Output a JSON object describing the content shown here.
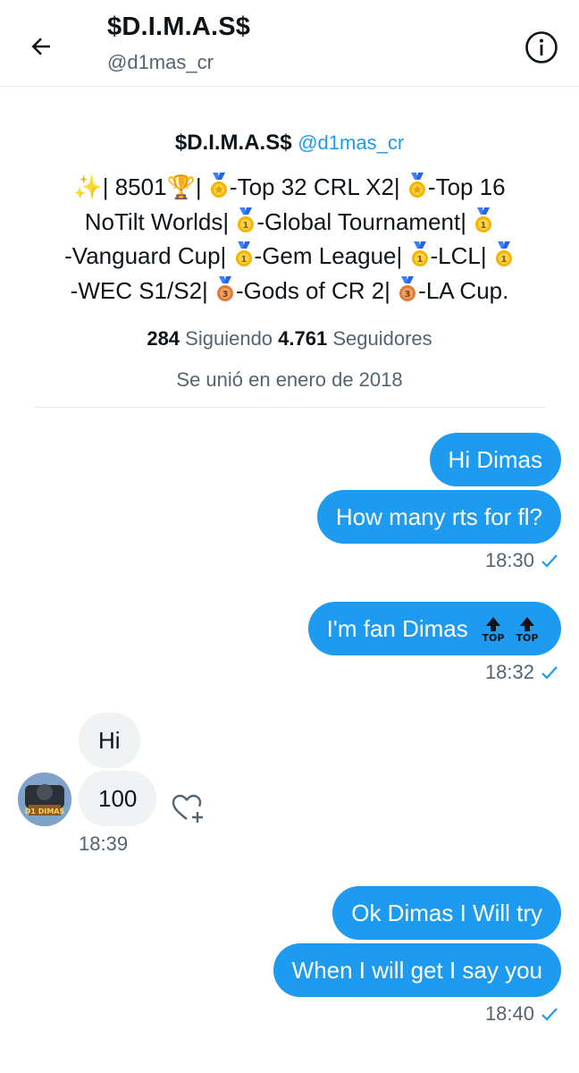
{
  "header": {
    "title": "$D.I.M.A.S$",
    "handle": "@d1mas_cr"
  },
  "profile": {
    "name": "$D.I.M.A.S$",
    "handle": "@d1mas_cr",
    "bio": {
      "l1_sparkle": "✨",
      "l1_a": "| 8501",
      "l1_trophy": "🏆",
      "l1_b": "| ",
      "l1_c": "-Top 32 CRL X2| ",
      "l1_d": "-Top 16",
      "l2_a": "NoTilt Worlds| ",
      "l2_b": "-Global Tournament| ",
      "l3_a": "-Vanguard Cup| ",
      "l3_b": "-Gem League| ",
      "l3_c": "-LCL| ",
      "l4_a": "-WEC S1/S2| ",
      "l4_b": "-Gods of CR 2| ",
      "l4_c": "-LA Cup."
    },
    "following_count": "284",
    "following_label": "Siguiendo",
    "followers_count": "4.761",
    "followers_label": "Seguidores",
    "joined": "Se unió en enero de 2018"
  },
  "messages": {
    "m1": "Hi Dimas",
    "m2": "How many rts for fl?",
    "t1": "18:30",
    "m3": "I'm fan Dimas",
    "t2": "18:32",
    "r1": "Hi",
    "r2": "100",
    "t3": "18:39",
    "m4": "Ok Dimas I Will try",
    "m5": "When I will get I say you",
    "t4": "18:40"
  },
  "avatar_text": "D1 DIMAS",
  "colors": {
    "accent": "#1d9bf0",
    "incoming_bg": "#eff3f4",
    "muted": "#536471",
    "gold": "#f4b400",
    "bronze": "#e07b39"
  },
  "icons": [
    "back-arrow-icon",
    "info-icon",
    "medal-gold-icon",
    "medal-bronze-icon",
    "top-arrow-icon",
    "read-check-icon",
    "heart-plus-icon"
  ]
}
